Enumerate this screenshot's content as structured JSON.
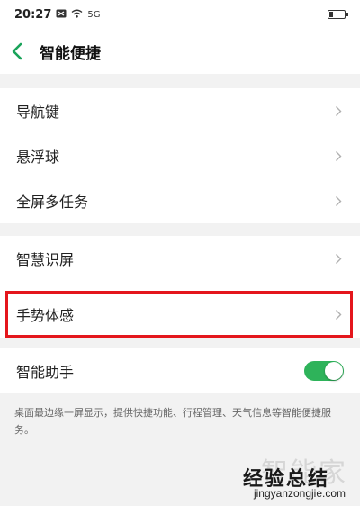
{
  "status_bar": {
    "time": "20:27",
    "network_label": "5G",
    "battery_level": 0.25
  },
  "header": {
    "title": "智能便捷",
    "back_icon": "chevron-left-icon",
    "back_color": "#1aa35a"
  },
  "sections": [
    {
      "items": [
        {
          "label": "导航键"
        },
        {
          "label": "悬浮球"
        },
        {
          "label": "全屏多任务"
        }
      ]
    },
    {
      "items": [
        {
          "label": "智慧识屏"
        },
        {
          "label": "手势体感"
        }
      ]
    }
  ],
  "assistant": {
    "label": "智能助手",
    "enabled": true,
    "toggle_color": "#2eb35a"
  },
  "description": "桌面最边缘一屏显示，提供快捷功能、行程管理、天气信息等智能便捷服务。",
  "watermark": {
    "faint": "智能家",
    "main": "经验总结",
    "url": "jingyanzongjie.com"
  },
  "highlight_color": "#e4161c"
}
